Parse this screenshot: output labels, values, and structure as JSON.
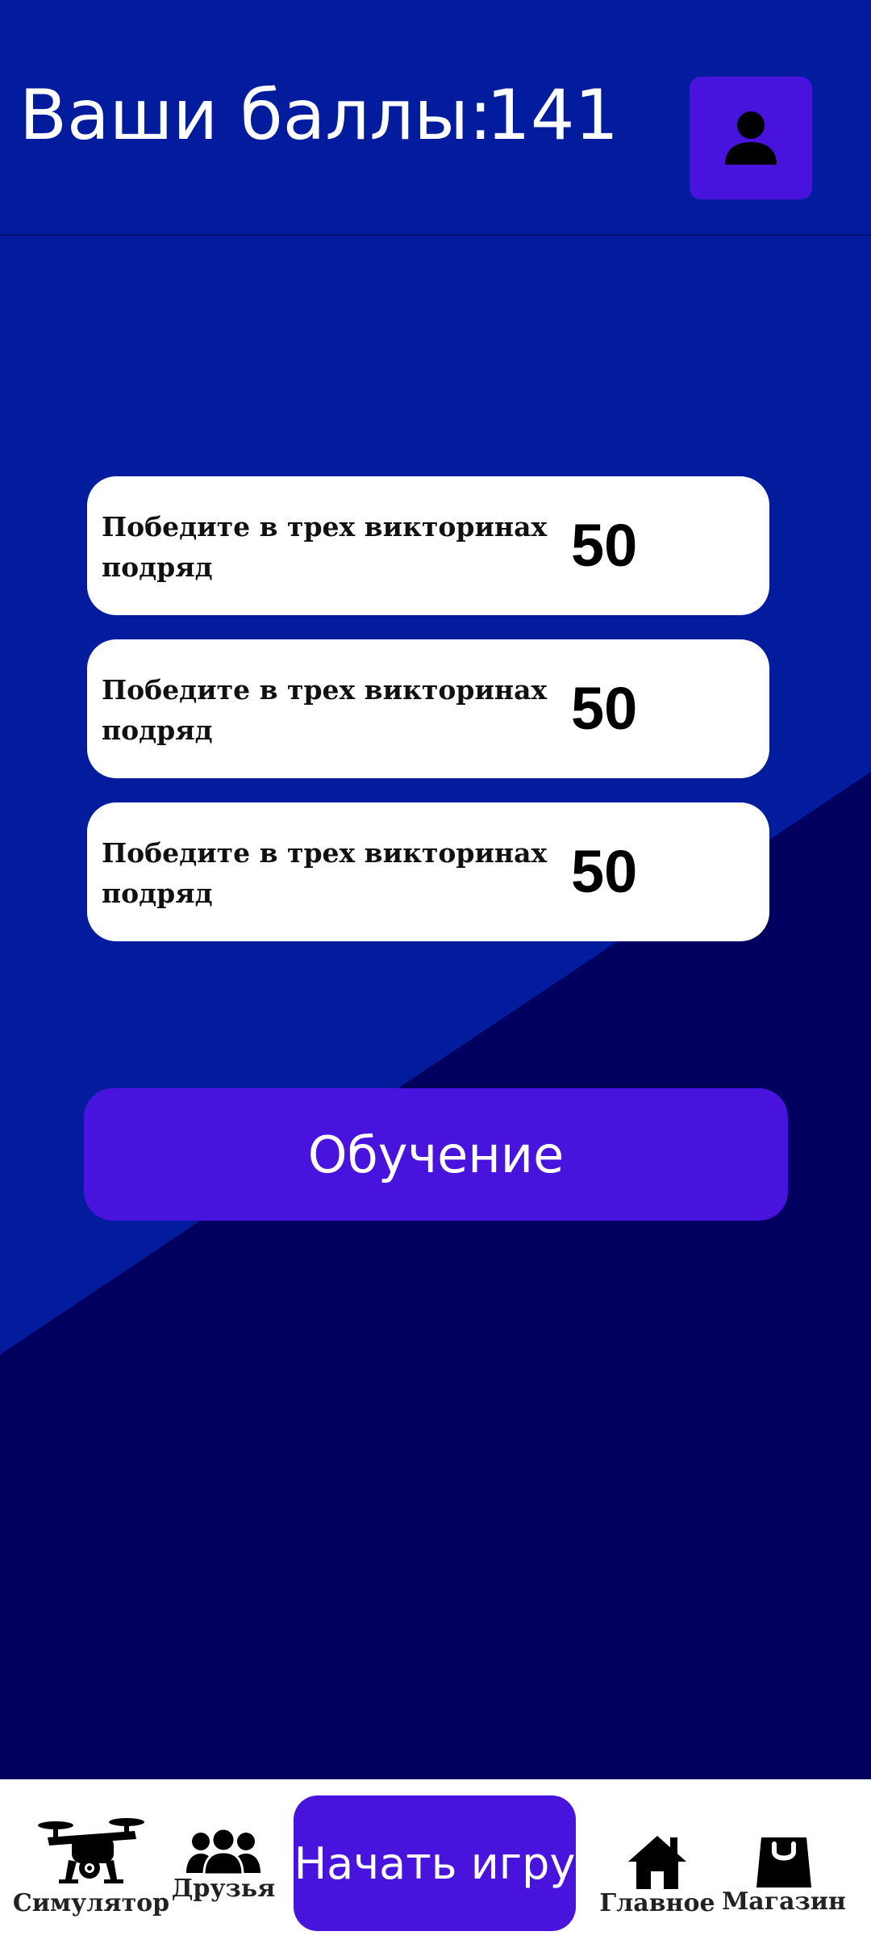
{
  "header": {
    "score_label": "Ваши баллы:",
    "score_value": "141",
    "profile_icon": "person-icon"
  },
  "tasks": [
    {
      "text": "Победите в трех викторинах подряд",
      "points": "50"
    },
    {
      "text": "Победите в трех викторинах подряд",
      "points": "50"
    },
    {
      "text": "Победите в трех викторинах подряд",
      "points": "50"
    }
  ],
  "learn_button": {
    "label": "Обучение"
  },
  "bottom_nav": {
    "simulator": {
      "label": "Симулятор",
      "icon": "drone-icon"
    },
    "friends": {
      "label": "Друзья",
      "icon": "friends-icon"
    },
    "start_game": {
      "label": "Начать игру"
    },
    "home": {
      "label": "Главное",
      "icon": "home-icon"
    },
    "shop": {
      "label": "Магазин",
      "icon": "shopping-bag-icon"
    }
  },
  "colors": {
    "primary_blue": "#021c9d",
    "dark_navy": "#01005e",
    "accent_purple": "#4813dc",
    "card_white": "#ffffff"
  }
}
